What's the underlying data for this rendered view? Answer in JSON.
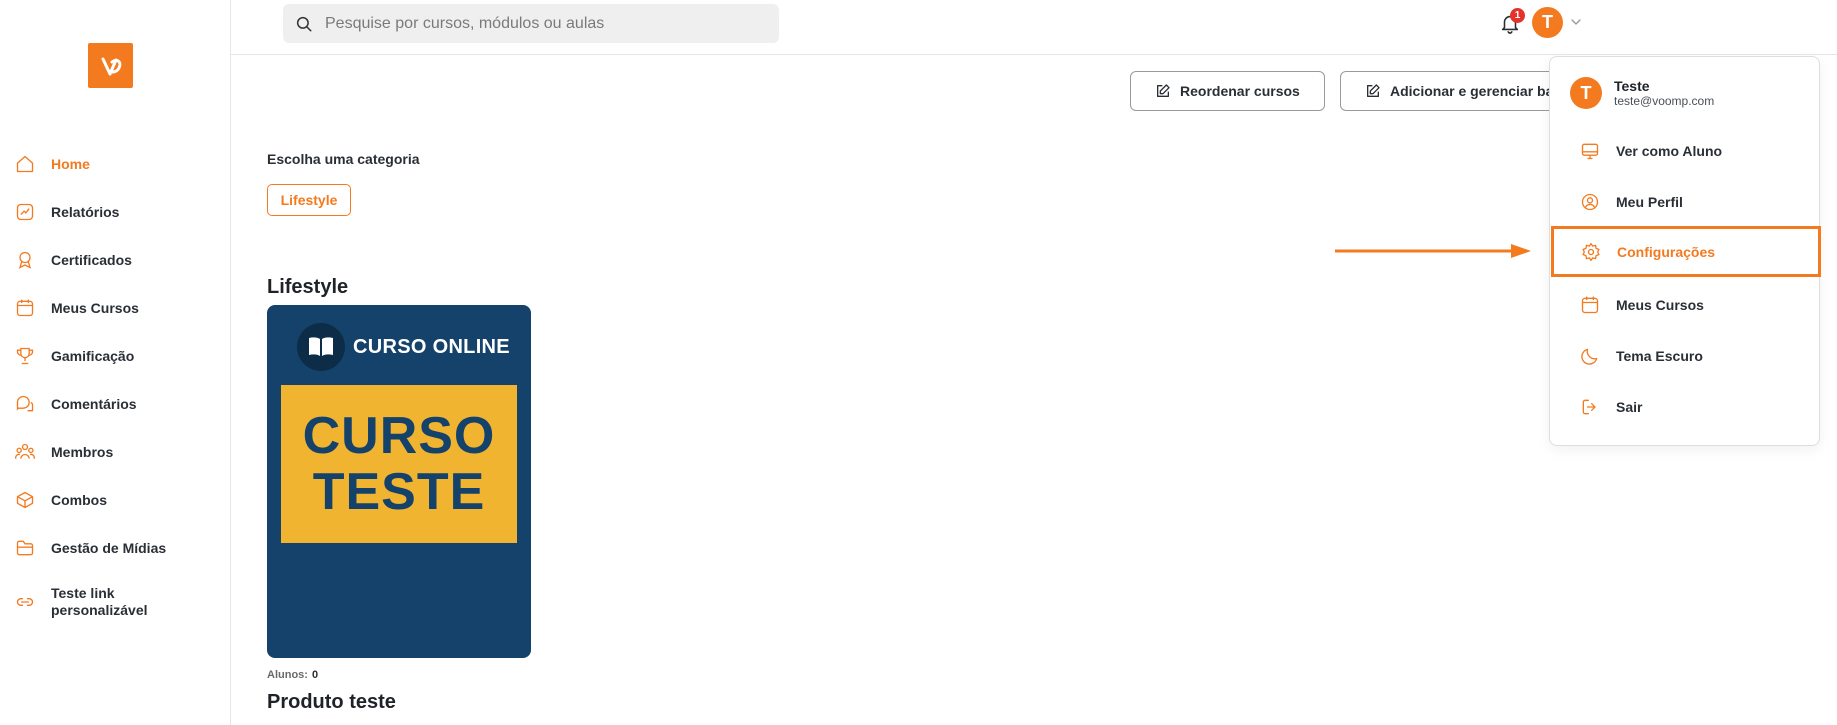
{
  "colors": {
    "accent": "#f47a20",
    "badge": "#e5322d",
    "card_bg": "#14426a",
    "card_yellow": "#f1b431"
  },
  "sidebar": {
    "items": [
      {
        "label": "Home",
        "icon": "home-icon",
        "active": true
      },
      {
        "label": "Relatórios",
        "icon": "chart-icon"
      },
      {
        "label": "Certificados",
        "icon": "award-icon"
      },
      {
        "label": "Meus Cursos",
        "icon": "calendar-icon"
      },
      {
        "label": "Gamificação",
        "icon": "trophy-icon"
      },
      {
        "label": "Comentários",
        "icon": "comments-icon"
      },
      {
        "label": "Membros",
        "icon": "members-icon"
      },
      {
        "label": "Combos",
        "icon": "box-icon"
      },
      {
        "label": "Gestão de Mídias",
        "icon": "folder-icon"
      },
      {
        "label": "Teste link personalizável",
        "icon": "link-icon"
      }
    ]
  },
  "topbar": {
    "search_placeholder": "Pesquise por cursos, módulos ou aulas",
    "notification_count": "1",
    "avatar_initial": "T"
  },
  "main": {
    "reorder_label": "Reordenar cursos",
    "add_label": "Adicionar e gerenciar banner",
    "category_prompt": "Escolha uma categoria",
    "category_chip": "Lifestyle",
    "section_title": "Lifestyle",
    "card": {
      "badge_text": "CURSO ONLINE",
      "line1": "CURSO",
      "line2": "TESTE"
    },
    "students_label": "Alunos:",
    "students_value": "0",
    "product_title": "Produto teste"
  },
  "dropdown": {
    "user_initial": "T",
    "user_name": "Teste",
    "user_email": "teste@voomp.com",
    "items": [
      {
        "label": "Ver como Aluno",
        "icon": "monitor-icon"
      },
      {
        "label": "Meu Perfil",
        "icon": "user-circle-icon"
      },
      {
        "label": "Configurações",
        "icon": "gear-icon",
        "highlighted": true
      },
      {
        "label": "Meus Cursos",
        "icon": "calendar-icon"
      },
      {
        "label": "Tema Escuro",
        "icon": "moon-icon"
      },
      {
        "label": "Sair",
        "icon": "logout-icon"
      }
    ]
  }
}
